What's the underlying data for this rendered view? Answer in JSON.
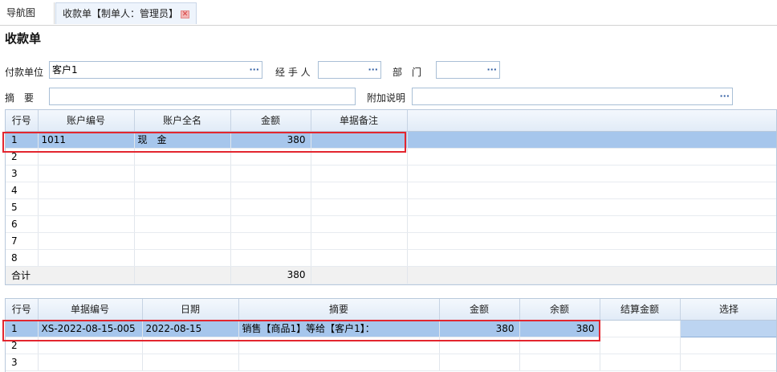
{
  "tabs": [
    {
      "label": "导航图"
    },
    {
      "label": "收款单【制单人：管理员】"
    }
  ],
  "page_title": "收款单",
  "form": {
    "payer_label": "付款单位",
    "payer_value": "客户1",
    "handler_label": "经 手 人",
    "handler_value": "",
    "dept_label": "部　门",
    "dept_value": "",
    "summary_label": "摘　要",
    "summary_value": "",
    "note_label": "附加说明",
    "note_value": "",
    "lookup_glyph": "···"
  },
  "account_grid": {
    "columns": [
      "行号",
      "账户编号",
      "账户全名",
      "金额",
      "单据备注"
    ],
    "rows": [
      {
        "no": "1",
        "code": "1011",
        "name": "现　金",
        "amount": "380",
        "remark": ""
      },
      {
        "no": "2",
        "code": "",
        "name": "",
        "amount": "",
        "remark": ""
      },
      {
        "no": "3",
        "code": "",
        "name": "",
        "amount": "",
        "remark": ""
      },
      {
        "no": "4",
        "code": "",
        "name": "",
        "amount": "",
        "remark": ""
      },
      {
        "no": "5",
        "code": "",
        "name": "",
        "amount": "",
        "remark": ""
      },
      {
        "no": "6",
        "code": "",
        "name": "",
        "amount": "",
        "remark": ""
      },
      {
        "no": "7",
        "code": "",
        "name": "",
        "amount": "",
        "remark": ""
      },
      {
        "no": "8",
        "code": "",
        "name": "",
        "amount": "",
        "remark": ""
      }
    ],
    "total_label": "合计",
    "total_amount": "380"
  },
  "bill_grid": {
    "columns": [
      "行号",
      "单据编号",
      "日期",
      "摘要",
      "金额",
      "余额",
      "结算金额",
      "选择"
    ],
    "rows": [
      {
        "no": "1",
        "code": "XS-2022-08-15-005",
        "date": "2022-08-15",
        "summary": "销售【商品1】等给【客户1】：",
        "amount": "380",
        "balance": "380",
        "settle": "",
        "select": ""
      },
      {
        "no": "2",
        "code": "",
        "date": "",
        "summary": "",
        "amount": "",
        "balance": "",
        "settle": "",
        "select": ""
      },
      {
        "no": "3",
        "code": "",
        "date": "",
        "summary": "",
        "amount": "",
        "balance": "",
        "settle": "",
        "select": ""
      }
    ]
  },
  "colors": {
    "selected_row": "#a6c6ec",
    "highlight_border": "#e3262f",
    "field_border": "#a9bfd6"
  }
}
